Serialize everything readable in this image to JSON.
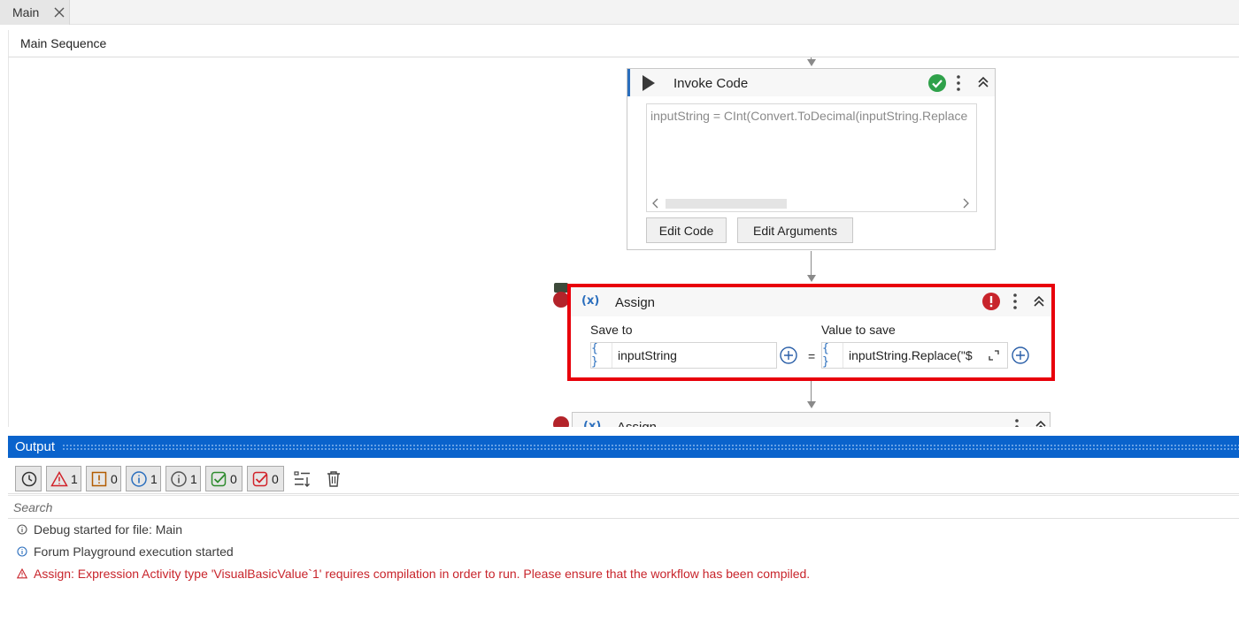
{
  "tabs": [
    {
      "label": "Main"
    }
  ],
  "breadcrumb": "Main Sequence",
  "invoke_code": {
    "title": "Invoke Code",
    "status_icon": "check-circle-icon",
    "code": "inputString = CInt(Convert.ToDecimal(inputString.Replace",
    "edit_code_label": "Edit Code",
    "edit_arguments_label": "Edit Arguments"
  },
  "assign": {
    "title": "Assign",
    "icon_label": "(x)",
    "error_icon": "error-icon",
    "save_to_label": "Save to",
    "value_to_save_label": "Value to save",
    "save_to_value": "inputString",
    "value_to_save_value": "inputString.Replace(\"$",
    "braces": "{ }",
    "equals": "="
  },
  "assign_next": {
    "title": "Assign",
    "icon_label": "(x)"
  },
  "output": {
    "title": "Output",
    "filters": [
      {
        "name": "errors",
        "count": "1",
        "color": "#d1232a"
      },
      {
        "name": "warnings",
        "count": "0",
        "color": "#b25b00"
      },
      {
        "name": "info",
        "count": "1",
        "color": "#2a6ebd"
      },
      {
        "name": "trace",
        "count": "1",
        "color": "#555555"
      },
      {
        "name": "success",
        "count": "0",
        "color": "#2e8b2e"
      },
      {
        "name": "failures",
        "count": "0",
        "color": "#d1232a"
      }
    ],
    "search_placeholder": "Search",
    "log": [
      {
        "type": "trace",
        "text": "Debug started for file: Main"
      },
      {
        "type": "info",
        "text": "Forum Playground execution started"
      },
      {
        "type": "error",
        "text": "Assign: Expression Activity type 'VisualBasicValue`1' requires compilation in order to run.  Please ensure that the workflow has been compiled."
      }
    ]
  },
  "colors": {
    "accent": "#0a63cc",
    "error": "#e8000b",
    "breakpoint": "#b3232a"
  }
}
